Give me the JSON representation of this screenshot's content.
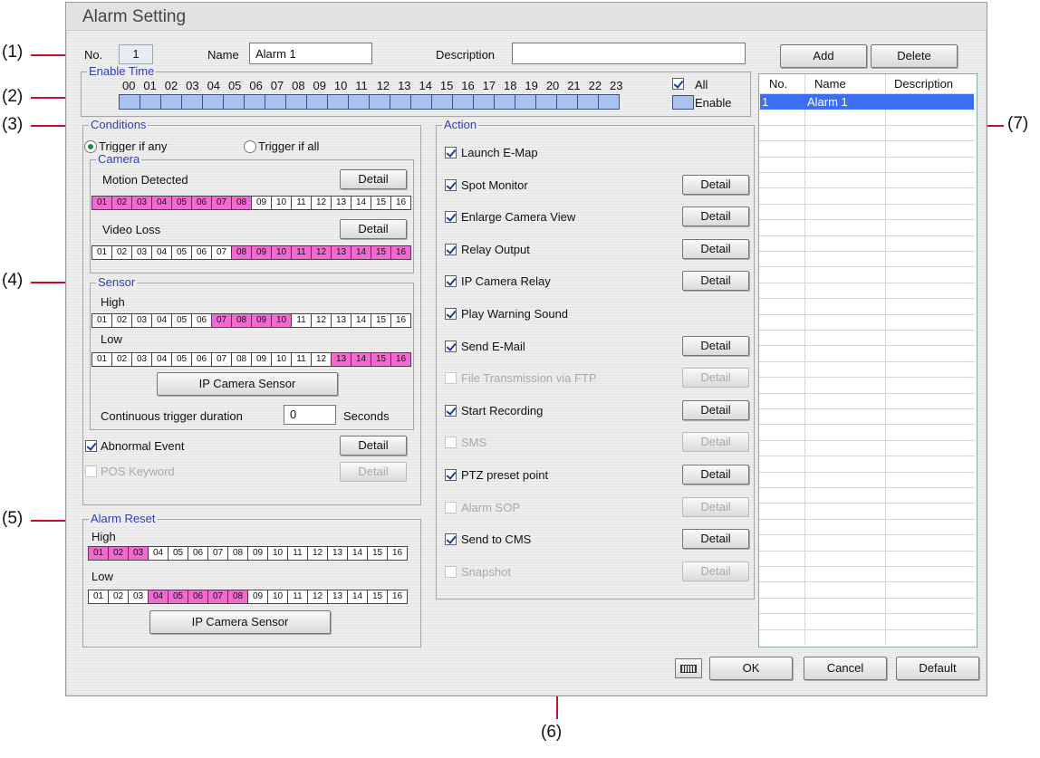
{
  "window": {
    "title": "Alarm Setting"
  },
  "callouts": [
    "(1)",
    "(2)",
    "(3)",
    "(4)",
    "(5)",
    "(6)",
    "(7)"
  ],
  "header": {
    "no_label": "No.",
    "no_value": "1",
    "name_label": "Name",
    "name_value": "Alarm 1",
    "description_label": "Description",
    "description_value": "",
    "add_button": "Add",
    "delete_button": "Delete"
  },
  "enable_time": {
    "title": "Enable Time",
    "hours": [
      "00",
      "01",
      "02",
      "03",
      "04",
      "05",
      "06",
      "07",
      "08",
      "09",
      "10",
      "11",
      "12",
      "13",
      "14",
      "15",
      "16",
      "17",
      "18",
      "19",
      "20",
      "21",
      "22",
      "23"
    ],
    "all_label": "All",
    "all_checked": true,
    "enable_label": "Enable"
  },
  "conditions": {
    "title": "Conditions",
    "trigger_any": "Trigger if any",
    "trigger_all": "Trigger if all",
    "selected": "any",
    "camera": {
      "title": "Camera",
      "motion_label": "Motion Detected",
      "motion_detail": "Detail",
      "motion_channels": [
        1,
        2,
        3,
        4,
        5,
        6,
        7,
        8
      ],
      "video_loss_label": "Video Loss",
      "video_loss_detail": "Detail",
      "video_loss_channels": [
        8,
        9,
        10,
        11,
        12,
        13,
        14,
        15,
        16
      ]
    },
    "sensor": {
      "title": "Sensor",
      "high_label": "High",
      "high_channels": [
        7,
        8,
        9,
        10
      ],
      "low_label": "Low",
      "low_channels": [
        13,
        14,
        15,
        16
      ],
      "ip_sensor_button": "IP Camera Sensor",
      "duration_label": "Continuous trigger duration",
      "duration_value": "0",
      "duration_unit": "Seconds"
    },
    "abnormal_label": "Abnormal Event",
    "abnormal_checked": true,
    "abnormal_detail": "Detail",
    "pos_label": "POS Keyword",
    "pos_detail": "Detail"
  },
  "channels": [
    "01",
    "02",
    "03",
    "04",
    "05",
    "06",
    "07",
    "08",
    "09",
    "10",
    "11",
    "12",
    "13",
    "14",
    "15",
    "16"
  ],
  "alarm_reset": {
    "title": "Alarm Reset",
    "high_label": "High",
    "high_channels": [
      1,
      2,
      3
    ],
    "low_label": "Low",
    "low_channels": [
      4,
      5,
      6,
      7,
      8
    ],
    "ip_sensor_button": "IP Camera Sensor"
  },
  "action": {
    "title": "Action",
    "items": [
      {
        "label": "Launch E-Map",
        "checked": true,
        "enabled": true,
        "detail": ""
      },
      {
        "label": "Spot Monitor",
        "checked": true,
        "enabled": true,
        "detail": "Detail"
      },
      {
        "label": "Enlarge Camera View",
        "checked": true,
        "enabled": true,
        "detail": "Detail"
      },
      {
        "label": "Relay Output",
        "checked": true,
        "enabled": true,
        "detail": "Detail"
      },
      {
        "label": "IP Camera Relay",
        "checked": true,
        "enabled": true,
        "detail": "Detail"
      },
      {
        "label": "Play Warning Sound",
        "checked": true,
        "enabled": true,
        "detail": ""
      },
      {
        "label": "Send E-Mail",
        "checked": true,
        "enabled": true,
        "detail": "Detail"
      },
      {
        "label": "File Transmission via FTP",
        "checked": false,
        "enabled": false,
        "detail": "Detail"
      },
      {
        "label": "Start Recording",
        "checked": true,
        "enabled": true,
        "detail": "Detail"
      },
      {
        "label": "SMS",
        "checked": false,
        "enabled": false,
        "detail": "Detail"
      },
      {
        "label": "PTZ preset point",
        "checked": true,
        "enabled": true,
        "detail": "Detail"
      },
      {
        "label": "Alarm SOP",
        "checked": false,
        "enabled": false,
        "detail": "Detail"
      },
      {
        "label": "Send to CMS",
        "checked": true,
        "enabled": true,
        "detail": "Detail"
      },
      {
        "label": "Snapshot",
        "checked": false,
        "enabled": false,
        "detail": "Detail"
      }
    ]
  },
  "alarm_list": {
    "columns": [
      "No.",
      "Name",
      "Description"
    ],
    "rows": [
      {
        "no": "1",
        "name": "Alarm 1",
        "description": ""
      }
    ]
  },
  "footer": {
    "ok": "OK",
    "cancel": "Cancel",
    "default": "Default"
  },
  "colors": {
    "accent": "#2c3fbf",
    "selected_cell": "#f16ad0",
    "time_cell": "#a9c3ee",
    "selected_row": "#3d6ff2",
    "callout_line": "#c8102e"
  }
}
